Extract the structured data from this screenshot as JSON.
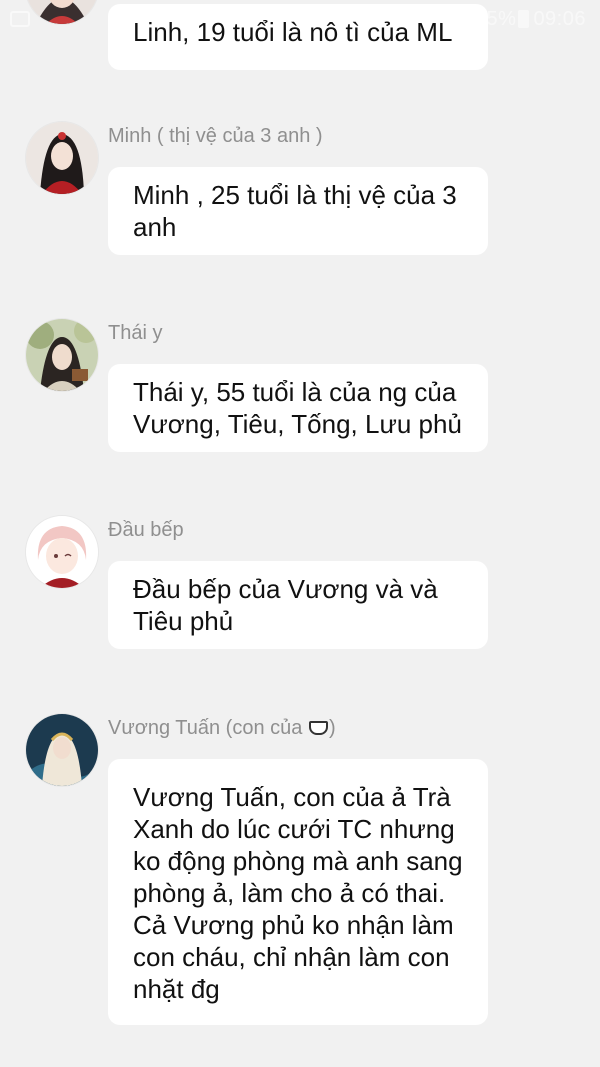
{
  "status_bar": {
    "battery": "5%",
    "time": "09:06"
  },
  "messages": [
    {
      "sender": "",
      "text": "Linh, 19 tuổi là nô tì của ML",
      "avatar": "avatar-linh"
    },
    {
      "sender": "Minh ( thị vệ của 3 anh )",
      "text": "Minh , 25 tuổi là thị vệ của 3 anh",
      "avatar": "avatar-minh"
    },
    {
      "sender": "Thái y",
      "text": "Thái y, 55 tuổi là của ng của Vương, Tiêu, Tống, Lưu phủ",
      "avatar": "avatar-thai-y"
    },
    {
      "sender": "Đầu bếp",
      "text": "Đầu bếp của Vương và và Tiêu phủ",
      "avatar": "avatar-dau-bep"
    },
    {
      "sender_prefix": "Vương Tuấn (con của ",
      "sender_suffix": ")",
      "sender_emoji": "tea-cup-icon",
      "text": "Vương Tuấn, con của ả Trà Xanh do lúc cưới TC nhưng ko động phòng mà anh sang phòng ả, làm cho ả có thai. Cả Vương phủ ko nhận làm con cháu, chỉ nhận làm con nhặt đg",
      "avatar": "avatar-vuong-tuan"
    }
  ]
}
